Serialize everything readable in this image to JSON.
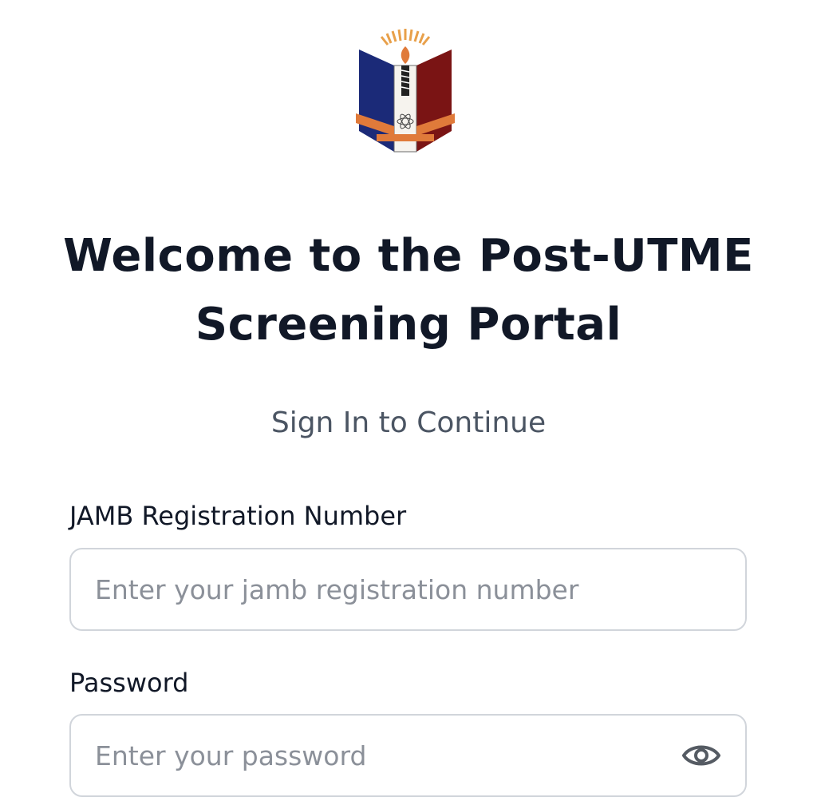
{
  "header": {
    "logo_icon": "university-crest-icon"
  },
  "title": {
    "line1": "Welcome to the Post-UTME",
    "line2": "Screening Portal"
  },
  "subtitle": "Sign In to Continue",
  "form": {
    "jamb": {
      "label": "JAMB Registration Number",
      "placeholder": "Enter your jamb registration number",
      "value": ""
    },
    "password": {
      "label": "Password",
      "placeholder": "Enter your password",
      "value": "",
      "toggle_icon": "eye-icon"
    }
  },
  "colors": {
    "text": "#111827",
    "muted": "#4b5563",
    "placeholder": "#8b9099",
    "border": "#d1d5db",
    "crest_blue": "#1b2a78",
    "crest_red": "#7a1414",
    "crest_orange": "#e07a3a"
  }
}
